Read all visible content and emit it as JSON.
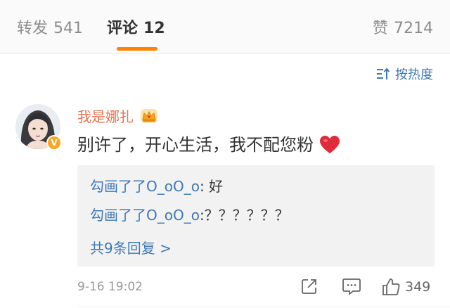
{
  "tabs": {
    "repost": {
      "label": "转发",
      "count": "541"
    },
    "comments": {
      "label": "评论",
      "count": "12"
    },
    "likes": {
      "label": "赞",
      "count": "7214"
    }
  },
  "sort": {
    "label": "按热度"
  },
  "comment": {
    "username": "我是娜扎",
    "text": "别许了，开心生活，我不配您粉",
    "timestamp": "9-16 19:02",
    "like_count": "349"
  },
  "replies": [
    {
      "name": "勾画了了O_oO_o",
      "sep": ": ",
      "text": "好"
    },
    {
      "name": "勾画了了O_oO_o",
      "sep": ":",
      "text": "？？？？？？"
    }
  ],
  "more_replies": "共9条回复 >",
  "colors": {
    "accent": "#ff8200",
    "link": "#3e79b6",
    "username": "#eb7350",
    "heart": "#e02b3a"
  },
  "icons": [
    "crown-badge-icon",
    "heart-emoji-icon",
    "sort-icon",
    "verified-badge-icon",
    "share-icon",
    "comment-icon",
    "like-icon"
  ]
}
